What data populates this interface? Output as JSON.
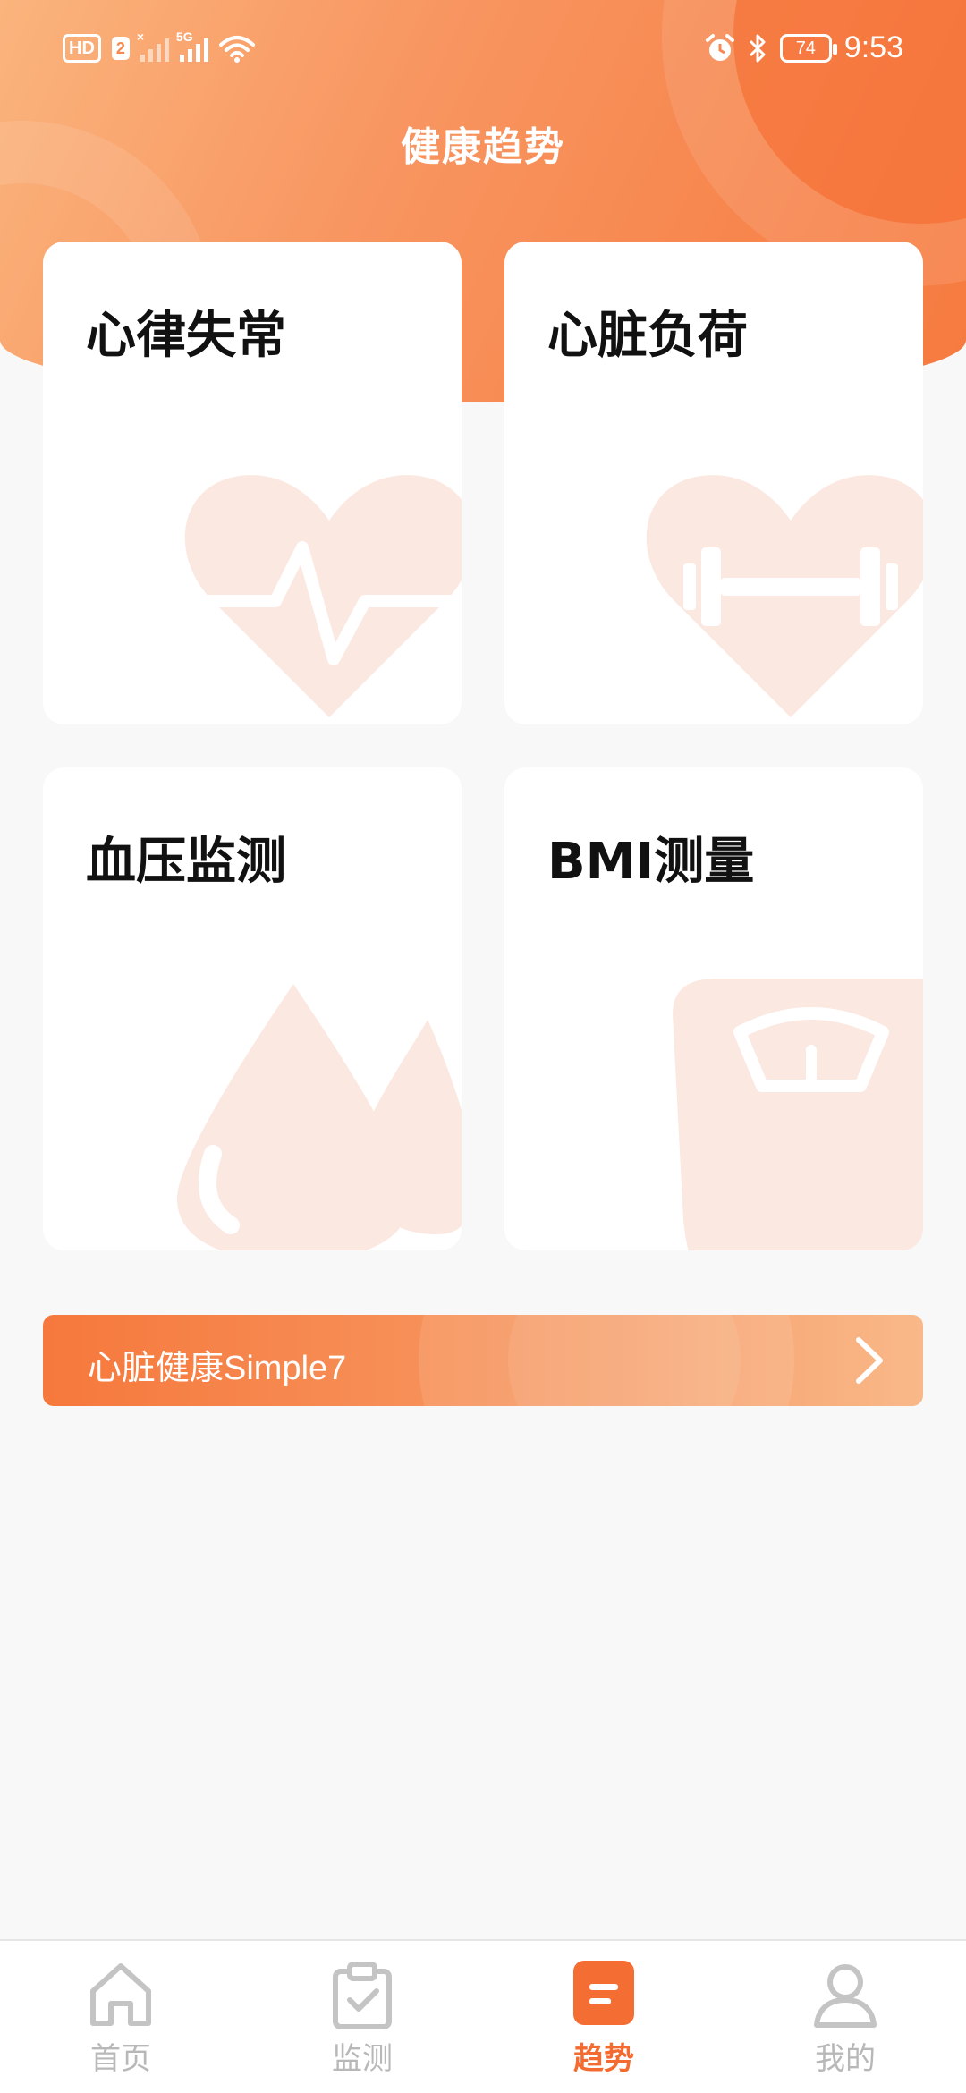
{
  "status_bar": {
    "hd": "HD",
    "sim": "2",
    "network": "5G",
    "battery": "74",
    "time": "9:53"
  },
  "header": {
    "title": "健康趋势"
  },
  "cards": [
    {
      "title": "心律失常",
      "icon": "heart-pulse-icon"
    },
    {
      "title": "心脏负荷",
      "icon": "heart-dumbbell-icon"
    },
    {
      "title": "血压监测",
      "icon": "blood-drop-icon"
    },
    {
      "title": "BMI测量",
      "icon": "scale-icon"
    }
  ],
  "banner": {
    "label": "心脏健康Simple7",
    "icon": "chevron-right-icon"
  },
  "nav": {
    "items": [
      {
        "label": "首页",
        "icon": "home-icon",
        "active": false
      },
      {
        "label": "监测",
        "icon": "clipboard-check-icon",
        "active": false
      },
      {
        "label": "趋势",
        "icon": "trend-icon",
        "active": true
      },
      {
        "label": "我的",
        "icon": "user-icon",
        "active": false
      }
    ]
  },
  "colors": {
    "accent": "#f36b31",
    "card_icon": "#fbe8e1",
    "inactive": "#b8b8b8"
  }
}
